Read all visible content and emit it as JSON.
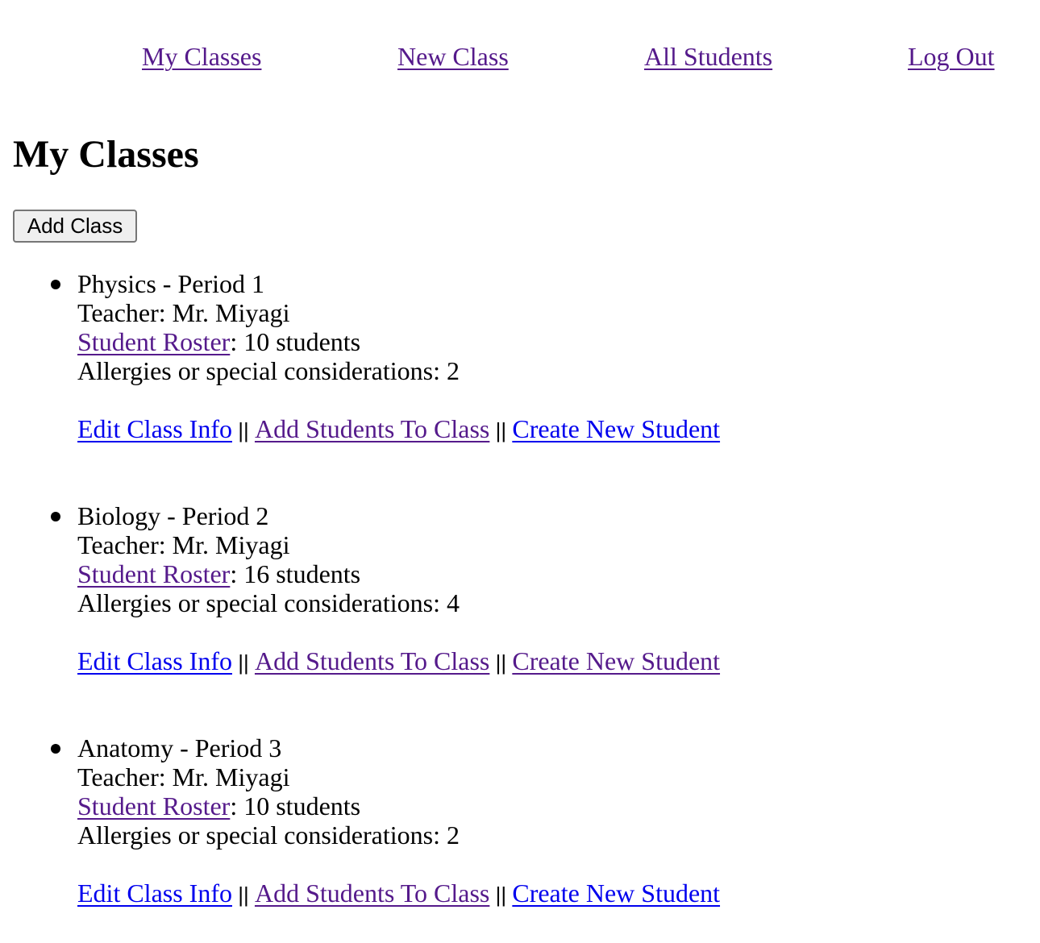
{
  "nav": {
    "items": [
      {
        "label": "My Classes"
      },
      {
        "label": "New Class"
      },
      {
        "label": "All Students"
      },
      {
        "label": "Log Out"
      }
    ]
  },
  "page_title": "My Classes",
  "add_class_button": "Add Class",
  "classes": [
    {
      "name": "Physics - Period 1",
      "teacher_line": "Teacher: Mr. Miyagi",
      "roster_link": "Student Roster",
      "roster_count": ": 10 students",
      "allergies_line": "Allergies or special considerations: 2",
      "actions": {
        "edit": "Edit Class Info",
        "sep1": " || ",
        "add_students": "Add Students To Class",
        "sep2": " || ",
        "create_student": "Create New Student"
      }
    },
    {
      "name": "Biology - Period 2",
      "teacher_line": "Teacher: Mr. Miyagi",
      "roster_link": "Student Roster",
      "roster_count": ": 16 students",
      "allergies_line": "Allergies or special considerations: 4",
      "actions": {
        "edit": "Edit Class Info",
        "sep1": " || ",
        "add_students": "Add Students To Class",
        "sep2": " || ",
        "create_student": "Create New Student"
      }
    },
    {
      "name": "Anatomy - Period 3",
      "teacher_line": "Teacher: Mr. Miyagi",
      "roster_link": "Student Roster",
      "roster_count": ": 10 students",
      "allergies_line": "Allergies or special considerations: 2",
      "actions": {
        "edit": "Edit Class Info",
        "sep1": " || ",
        "add_students": "Add Students To Class",
        "sep2": " || ",
        "create_student": "Create New Student"
      }
    }
  ],
  "colors": {
    "link_unvisited": "#0000ee",
    "link_visited": "#551a8b"
  }
}
